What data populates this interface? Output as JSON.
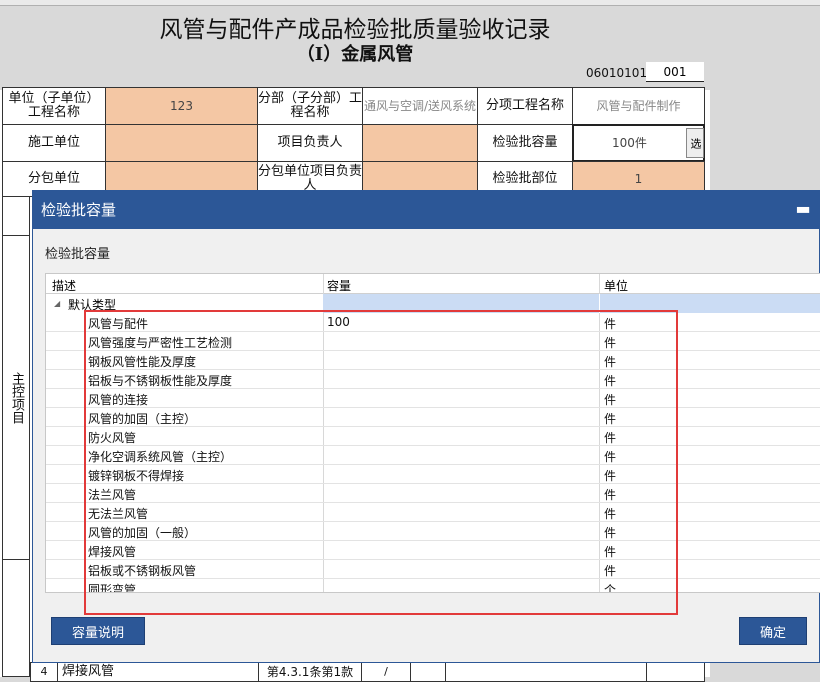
{
  "sheet": {
    "title": "风管与配件产成品检验批质量验收记录",
    "subtitle": "（I）金属风管",
    "code_label": "06010101",
    "code_value": "001",
    "cells": {
      "unit_label": "单位（子单位）工程名称",
      "unit_value": "123",
      "division_label": "分部（子分部）工程名称",
      "division_value": "通风与空调/送风系统",
      "subitem_label": "分项工程名称",
      "subitem_value": "风管与配件制作",
      "contractor_label": "施工单位",
      "pm_label": "项目负责人",
      "capacity_label": "检验批容量",
      "capacity_value": "100件",
      "select_label": "选",
      "sub_contractor_label": "分包单位",
      "sub_pm_label": "分包单位项目负责人",
      "location_label": "检验批部位",
      "location_value": "1",
      "main_control_label": "主控项目",
      "bottom_row_index": "4",
      "bottom_row_name": "焊接风管",
      "bottom_row_clause": "第4.3.1条第1款",
      "bottom_row_mark": "/"
    }
  },
  "dialog": {
    "title": "检验批容量",
    "min_icon": "minimize-icon",
    "section_label": "检验批容量",
    "columns": [
      "描述",
      "容量",
      "单位"
    ],
    "group_label": "默认类型",
    "rows": [
      {
        "name": "风管与配件",
        "capacity": "100",
        "unit": "件"
      },
      {
        "name": "风管强度与严密性工艺检测",
        "capacity": "",
        "unit": "件"
      },
      {
        "name": "钢板风管性能及厚度",
        "capacity": "",
        "unit": "件"
      },
      {
        "name": "铝板与不锈钢板性能及厚度",
        "capacity": "",
        "unit": "件"
      },
      {
        "name": "风管的连接",
        "capacity": "",
        "unit": "件"
      },
      {
        "name": "风管的加固（主控）",
        "capacity": "",
        "unit": "件"
      },
      {
        "name": "防火风管",
        "capacity": "",
        "unit": "件"
      },
      {
        "name": "净化空调系统风管（主控）",
        "capacity": "",
        "unit": "件"
      },
      {
        "name": "镀锌钢板不得焊接",
        "capacity": "",
        "unit": "件"
      },
      {
        "name": "法兰风管",
        "capacity": "",
        "unit": "件"
      },
      {
        "name": "无法兰风管",
        "capacity": "",
        "unit": "件"
      },
      {
        "name": "风管的加固（一般）",
        "capacity": "",
        "unit": "件"
      },
      {
        "name": "焊接风管",
        "capacity": "",
        "unit": "件"
      },
      {
        "name": "铝板或不锈钢板风管",
        "capacity": "",
        "unit": "件"
      },
      {
        "name": "圆形弯管",
        "capacity": "",
        "unit": "个"
      }
    ],
    "btn_help": "容量说明",
    "btn_ok": "确定",
    "colors": {
      "title_bar": "#2c5797",
      "highlight": "#e23a3a",
      "group_fill": "#cbdcf4"
    }
  }
}
